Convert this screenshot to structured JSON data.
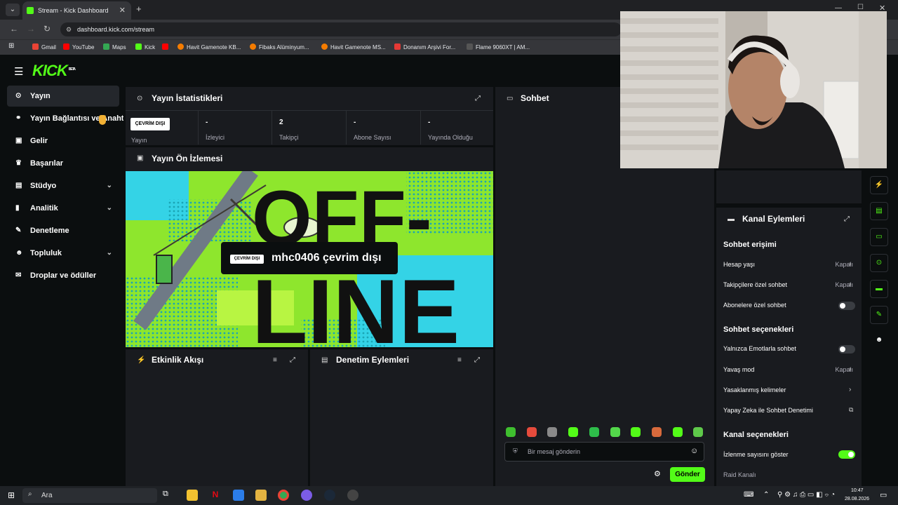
{
  "browser": {
    "tab_title": "Stream - Kick Dashboard",
    "url": "dashboard.kick.com/stream",
    "bookmarks": [
      "Gmail",
      "YouTube",
      "Maps",
      "Kick",
      "",
      "Havit Gamenote KB...",
      "Fibaks Alüminyum...",
      "Havit Gamenote MS...",
      "Donanım Arşivi For...",
      "Flame 9060XT | AM..."
    ]
  },
  "logo": {
    "text": "KICK",
    "beta": "BETA"
  },
  "sidebar": {
    "items": [
      {
        "label": "Yayın",
        "icon": "broadcast-icon"
      },
      {
        "label": "Yayın Bağlantısı ve Anahtarı",
        "icon": "link-icon"
      },
      {
        "label": "Gelir",
        "icon": "wallet-icon"
      },
      {
        "label": "Başarılar",
        "icon": "trophy-icon"
      },
      {
        "label": "Stüdyo",
        "icon": "studio-icon"
      },
      {
        "label": "Analitik",
        "icon": "chart-icon"
      },
      {
        "label": "Denetleme",
        "icon": "wrench-icon"
      },
      {
        "label": "Topluluk",
        "icon": "community-icon"
      },
      {
        "label": "Droplar ve ödüller",
        "icon": "gift-icon"
      }
    ]
  },
  "stats": {
    "title": "Yayın İstatistikleri",
    "status_chip": "ÇEVRİM DIŞI",
    "status_label": "Yayın",
    "items": [
      {
        "value": "-",
        "label": "İzleyici"
      },
      {
        "value": "2",
        "label": "Takipçi"
      },
      {
        "value": "-",
        "label": "Abone Sayısı"
      },
      {
        "value": "-",
        "label": "Yayında Olduğu"
      }
    ]
  },
  "preview": {
    "title": "Yayın Ön İzlemesi",
    "chip": "ÇEVRİM DIŞI",
    "message": "mhc0406 çevrim dışı",
    "bg_text_top": "OFF-",
    "bg_text_bottom": "LINE"
  },
  "activity": {
    "title": "Etkinlik Akışı"
  },
  "moderation": {
    "title": "Denetim Eylemleri"
  },
  "chat": {
    "title": "Sohbet",
    "placeholder": "Bir mesaj gönderin",
    "send": "Gönder",
    "emote_colors": [
      "#3fbf2f",
      "#e64b3c",
      "#8a8a8a",
      "#53fc18",
      "#2ebd4a",
      "#53d84b",
      "#53fc18",
      "#d86a3c",
      "#53fc18",
      "#5fc94a"
    ]
  },
  "channel": {
    "title": "Kanal Eylemleri",
    "section1": "Sohbet erişimi",
    "hesap_yasi": "Hesap yaşı",
    "hesap_yasi_val": "Kapalı",
    "takipci": "Takipçilere özel sohbet",
    "takipci_val": "Kapalı",
    "abone": "Abonelere özel sohbet",
    "section2": "Sohbet seçenekleri",
    "emote": "Yalnızca Emotlarla sohbet",
    "yavas": "Yavaş mod",
    "yavas_val": "Kapalı",
    "yasak": "Yasaklanmış kelimeler",
    "yapay": "Yapay Zeka ile Sohbet Denetimi",
    "section3": "Kanal seçenekleri",
    "izlenme": "İzlenme sayısını göster",
    "raid": "Raid Kanalı"
  },
  "taskbar": {
    "search": "Ara",
    "time": "10:47",
    "date": "28.08.2026"
  },
  "colors": {
    "accent": "#53fc18",
    "panel": "#191b1f",
    "bg": "#0b0e0f"
  }
}
